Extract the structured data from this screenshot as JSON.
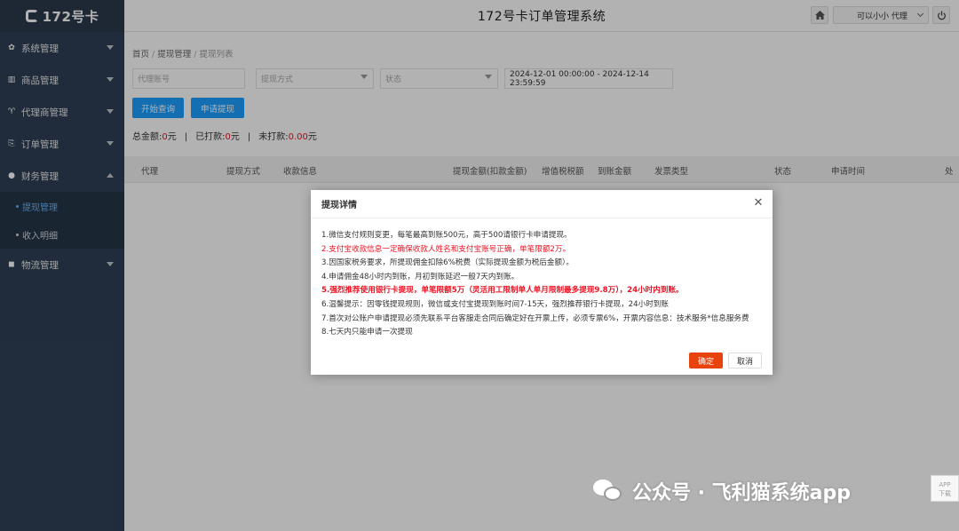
{
  "app": {
    "logo_text": "172号卡",
    "header_title": "172号卡订单管理系统",
    "user_name": "可以小小 代理"
  },
  "sidebar": {
    "items": [
      {
        "label": "系统管理",
        "icon": "gear-icon"
      },
      {
        "label": "商品管理",
        "icon": "product-icon"
      },
      {
        "label": "代理商管理",
        "icon": "agent-icon"
      },
      {
        "label": "订单管理",
        "icon": "order-icon"
      },
      {
        "label": "财务管理",
        "icon": "finance-icon"
      },
      {
        "label": "物流管理",
        "icon": "logistics-icon"
      }
    ],
    "finance_sub": [
      "提现管理",
      "收入明细"
    ]
  },
  "breadcrumb": {
    "home": "首页",
    "level1": "提现管理",
    "level2": "提现列表"
  },
  "filters": {
    "agent_placeholder": "代理账号",
    "method_placeholder": "提现方式",
    "status_placeholder": "状态",
    "date_range": "2024-12-01 00:00:00 - 2024-12-14 23:59:59"
  },
  "buttons": {
    "search": "开始查询",
    "apply": "申请提现"
  },
  "totals": {
    "total_label": "总金额:",
    "total_value": "0",
    "paid_label": "已打款:",
    "paid_value": "0",
    "unpaid_label": "未打款:",
    "unpaid_value": "0.00",
    "unit": "元"
  },
  "table": {
    "columns": [
      "代理",
      "提现方式",
      "收款信息",
      "提现金额(扣款金额)",
      "增值税税额",
      "到账金额",
      "发票类型",
      "状态",
      "申请时间",
      "处"
    ]
  },
  "modal": {
    "title": "提现详情",
    "lines": [
      "1.微信支付规则变更，每笔最高到账500元，高于500请银行卡申请提现。",
      "2.支付宝收款信息一定确保收款人姓名和支付宝账号正确，单笔限额2万。",
      "3.因国家税务要求，所提现佣金扣除6%税费（实际提现金额为税后金额）。",
      "4.申请佣金48小时内到账，月初到账延迟一般7天内到账。",
      "5.强烈推荐使用银行卡提现，单笔限额5万（灵活用工限制单人单月限制最多提现9.8万），24小时内到账。",
      "6.温馨提示：因零钱提现规则，微信或支付宝提现到账时间7-15天，强烈推荐银行卡提现，24小时到账",
      "7.首次对公账户申请提现必须先联系平台客服走合同后确定好在开票上传，必须专票6%，开票内容信息：技术服务*信息服务费",
      "8.七天内只能申请一次提现"
    ],
    "ok": "确定",
    "cancel": "取消"
  },
  "watermark": "公众号 · 飞利猫系统app",
  "app_badge": {
    "line1": "APP",
    "line2": "下载"
  },
  "colors": {
    "sidebar_bg": "#2f4056",
    "accent_blue": "#1e9fff",
    "danger_red": "#e12",
    "ok_orange": "#e8430f"
  }
}
